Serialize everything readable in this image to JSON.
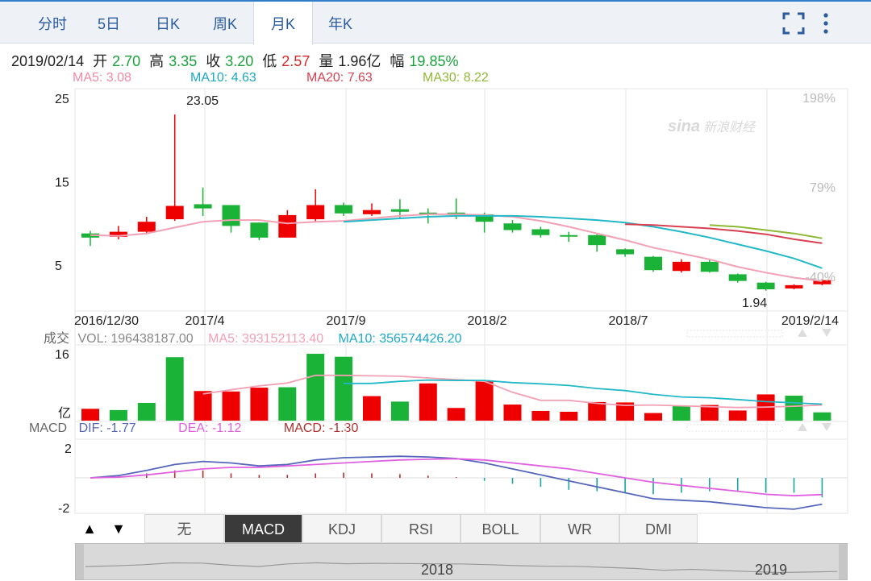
{
  "tabs": [
    {
      "label": "分时",
      "active": false
    },
    {
      "label": "5日",
      "active": false
    },
    {
      "label": "日K",
      "active": false
    },
    {
      "label": "周K",
      "active": false
    },
    {
      "label": "月K",
      "active": true
    },
    {
      "label": "年K",
      "active": false
    }
  ],
  "toolbar": {
    "fullscreen_icon": "fullscreen-icon",
    "more_icon": "more-icon"
  },
  "quote": {
    "date": "2019/02/14",
    "open_label": "开",
    "open": "2.70",
    "high_label": "高",
    "high": "3.35",
    "close_label": "收",
    "close": "3.20",
    "low_label": "低",
    "low": "2.57",
    "volume_label": "量",
    "volume": "1.96亿",
    "change_label": "幅",
    "change": "19.85%"
  },
  "ma_legend": {
    "ma5": "MA5: 3.08",
    "ma10": "MA10: 4.63",
    "ma20": "MA20: 7.63",
    "ma30": "MA30: 8.22"
  },
  "price_axis": {
    "ticks": [
      "25",
      "15",
      "5"
    ],
    "pct_ticks": [
      "198%",
      "79%",
      "-40%"
    ],
    "max_label": "23.05",
    "min_label": "1.94"
  },
  "watermark": "新浪财经",
  "watermark_logo": "sina",
  "date_labels": [
    "2016/12/30",
    "2017/4",
    "2017/9",
    "2018/2",
    "2018/7",
    "2019/2/14"
  ],
  "volume_legend": {
    "title": "成交",
    "vol": "VOL: 196438187.00",
    "ma5": "MA5: 393152113.40",
    "ma10": "MA10: 356574426.20",
    "axis_top": "16",
    "axis_unit": "亿"
  },
  "macd_legend": {
    "title": "MACD",
    "dif": "DIF: -1.77",
    "dea": "DEA: -1.12",
    "macd": "MACD: -1.30",
    "axis_top": "2",
    "axis_bottom": "-2"
  },
  "indicator_tabs": [
    "无",
    "MACD",
    "KDJ",
    "RSI",
    "BOLL",
    "WR",
    "DMI"
  ],
  "indicator_selected": "MACD",
  "nav_arrows": {
    "up": "▲",
    "down": "▼"
  },
  "navigator_labels": [
    "2018",
    "2019"
  ],
  "colors": {
    "up": "#ef0000",
    "down": "#1ab237",
    "ma5": "#f2a0b4",
    "ma10": "#22b8c8",
    "ma20": "#d84052",
    "ma30": "#8fb834",
    "dif": "#5566bb",
    "dea": "#e060e0",
    "accent": "#2d7dc8"
  },
  "chart_data": [
    {
      "type": "candlestick",
      "title": "",
      "ylim": [
        0,
        25
      ],
      "categories": [
        "2016/12",
        "2017/1",
        "2017/2",
        "2017/3",
        "2017/4",
        "2017/5",
        "2017/6",
        "2017/7",
        "2017/8",
        "2017/9",
        "2017/10",
        "2017/11",
        "2017/12",
        "2018/1",
        "2018/2",
        "2018/3",
        "2018/4",
        "2018/5",
        "2018/6",
        "2018/7",
        "2018/8",
        "2018/9",
        "2018/10",
        "2018/11",
        "2018/12",
        "2019/1",
        "2019/2"
      ],
      "candles": [
        {
          "o": 8.8,
          "c": 8.3,
          "h": 9.1,
          "l": 7.3
        },
        {
          "o": 8.4,
          "c": 9.0,
          "h": 9.7,
          "l": 8.1
        },
        {
          "o": 9.0,
          "c": 10.2,
          "h": 10.8,
          "l": 8.7
        },
        {
          "o": 10.5,
          "c": 12.1,
          "h": 23.05,
          "l": 10.3
        },
        {
          "o": 12.3,
          "c": 11.8,
          "h": 14.3,
          "l": 10.9
        },
        {
          "o": 12.2,
          "c": 9.7,
          "h": 12.2,
          "l": 8.9
        },
        {
          "o": 10.1,
          "c": 8.3,
          "h": 10.1,
          "l": 8.0
        },
        {
          "o": 8.3,
          "c": 11.0,
          "h": 11.6,
          "l": 8.3
        },
        {
          "o": 10.5,
          "c": 12.2,
          "h": 14.1,
          "l": 10.2
        },
        {
          "o": 12.2,
          "c": 11.2,
          "h": 12.5,
          "l": 10.9
        },
        {
          "o": 11.1,
          "c": 11.6,
          "h": 12.4,
          "l": 10.9
        },
        {
          "o": 11.7,
          "c": 11.4,
          "h": 12.9,
          "l": 10.6
        },
        {
          "o": 11.3,
          "c": 11.1,
          "h": 11.8,
          "l": 10.0
        },
        {
          "o": 11.3,
          "c": 11.0,
          "h": 13.0,
          "l": 10.5
        },
        {
          "o": 11.1,
          "c": 10.2,
          "h": 11.3,
          "l": 8.9
        },
        {
          "o": 10.0,
          "c": 9.2,
          "h": 10.4,
          "l": 8.9
        },
        {
          "o": 9.3,
          "c": 8.6,
          "h": 9.6,
          "l": 8.3
        },
        {
          "o": 8.6,
          "c": 8.5,
          "h": 9.0,
          "l": 7.8
        },
        {
          "o": 8.6,
          "c": 7.4,
          "h": 8.7,
          "l": 6.6
        },
        {
          "o": 6.9,
          "c": 6.3,
          "h": 7.0,
          "l": 6.0
        },
        {
          "o": 6.0,
          "c": 4.4,
          "h": 6.1,
          "l": 4.2
        },
        {
          "o": 4.3,
          "c": 5.4,
          "h": 5.7,
          "l": 4.1
        },
        {
          "o": 5.4,
          "c": 4.2,
          "h": 5.6,
          "l": 4.1
        },
        {
          "o": 3.9,
          "c": 3.1,
          "h": 4.0,
          "l": 2.9
        },
        {
          "o": 2.9,
          "c": 2.1,
          "h": 3.0,
          "l": 1.94
        },
        {
          "o": 2.2,
          "c": 2.6,
          "h": 2.7,
          "l": 2.1
        },
        {
          "o": 2.7,
          "c": 3.2,
          "h": 3.35,
          "l": 2.57
        }
      ],
      "series": [
        {
          "name": "MA5",
          "values": [
            8.6,
            8.5,
            8.8,
            9.5,
            10.2,
            10.4,
            10.4,
            10.0,
            10.2,
            10.3,
            10.6,
            10.9,
            11.1,
            11.1,
            11.0,
            10.8,
            10.3,
            9.6,
            8.8,
            8.0,
            7.1,
            6.4,
            5.7,
            4.8,
            4.1,
            3.5,
            3.08
          ]
        },
        {
          "name": "MA10",
          "values": [
            null,
            null,
            null,
            null,
            null,
            null,
            null,
            null,
            null,
            10.2,
            10.4,
            10.6,
            10.8,
            10.9,
            10.9,
            10.9,
            10.8,
            10.6,
            10.4,
            10.1,
            9.6,
            9.0,
            8.3,
            7.5,
            6.7,
            5.8,
            4.63
          ]
        },
        {
          "name": "MA20",
          "values": [
            null,
            null,
            null,
            null,
            null,
            null,
            null,
            null,
            null,
            null,
            null,
            null,
            null,
            null,
            null,
            null,
            null,
            null,
            null,
            9.9,
            9.8,
            9.6,
            9.4,
            9.1,
            8.7,
            8.1,
            7.63
          ]
        },
        {
          "name": "MA30",
          "values": [
            null,
            null,
            null,
            null,
            null,
            null,
            null,
            null,
            null,
            null,
            null,
            null,
            null,
            null,
            null,
            null,
            null,
            null,
            null,
            null,
            null,
            null,
            9.8,
            9.6,
            9.2,
            8.8,
            8.22
          ]
        }
      ]
    },
    {
      "type": "bar",
      "title": "成交",
      "ylabel": "亿",
      "ylim": [
        0,
        16
      ],
      "values": [
        2.8,
        2.5,
        4.2,
        15.0,
        7.0,
        6.9,
        7.8,
        7.9,
        15.8,
        15.1,
        5.8,
        4.5,
        8.8,
        3.0,
        9.5,
        3.8,
        2.3,
        2.1,
        4.4,
        4.3,
        1.8,
        3.5,
        3.7,
        2.4,
        6.2,
        5.9,
        1.96
      ],
      "directions": [
        "up",
        "down",
        "down",
        "down",
        "up",
        "up",
        "up",
        "down",
        "down",
        "down",
        "up",
        "down",
        "up",
        "up",
        "up",
        "up",
        "up",
        "up",
        "up",
        "up",
        "up",
        "down",
        "up",
        "up",
        "up",
        "down",
        "down"
      ],
      "series": [
        {
          "name": "MA5",
          "values": [
            null,
            null,
            null,
            null,
            6.3,
            7.3,
            8.2,
            8.9,
            10.7,
            10.7,
            10.6,
            10.5,
            10.1,
            9.7,
            9.3,
            6.7,
            4.8,
            4.8,
            4.1,
            3.6,
            3.7,
            3.5,
            3.3,
            3.1,
            3.2,
            3.4,
            3.7
          ]
        },
        {
          "name": "MA10",
          "values": [
            null,
            null,
            null,
            null,
            null,
            null,
            null,
            null,
            null,
            8.8,
            8.8,
            9.3,
            9.6,
            9.5,
            9.5,
            9.0,
            8.7,
            8.3,
            7.6,
            7.1,
            6.2,
            5.6,
            5.4,
            5.0,
            4.5,
            4.2,
            3.9
          ]
        }
      ]
    },
    {
      "type": "macd",
      "title": "MACD",
      "ylim": [
        -2,
        2
      ],
      "series": [
        {
          "name": "DIF",
          "values": [
            0.0,
            0.15,
            0.5,
            0.9,
            1.1,
            1.0,
            0.8,
            0.9,
            1.2,
            1.35,
            1.4,
            1.45,
            1.4,
            1.3,
            1.0,
            0.6,
            0.2,
            -0.2,
            -0.6,
            -1.0,
            -1.4,
            -1.5,
            -1.6,
            -1.8,
            -2.0,
            -2.1,
            -1.77
          ]
        },
        {
          "name": "DEA",
          "values": [
            0.0,
            0.05,
            0.2,
            0.4,
            0.6,
            0.7,
            0.7,
            0.8,
            0.9,
            1.0,
            1.1,
            1.2,
            1.25,
            1.28,
            1.2,
            1.0,
            0.8,
            0.6,
            0.3,
            0.0,
            -0.3,
            -0.5,
            -0.7,
            -0.9,
            -1.1,
            -1.2,
            -1.12
          ]
        },
        {
          "name": "MACD",
          "values": [
            0.0,
            0.1,
            0.3,
            0.5,
            0.5,
            0.3,
            0.2,
            0.2,
            0.3,
            0.35,
            0.3,
            0.25,
            0.15,
            0.05,
            -0.2,
            -0.4,
            -0.6,
            -0.8,
            -0.9,
            -1.0,
            -1.1,
            -1.0,
            -0.9,
            -0.9,
            -1.0,
            -1.0,
            -1.3
          ]
        }
      ]
    }
  ]
}
